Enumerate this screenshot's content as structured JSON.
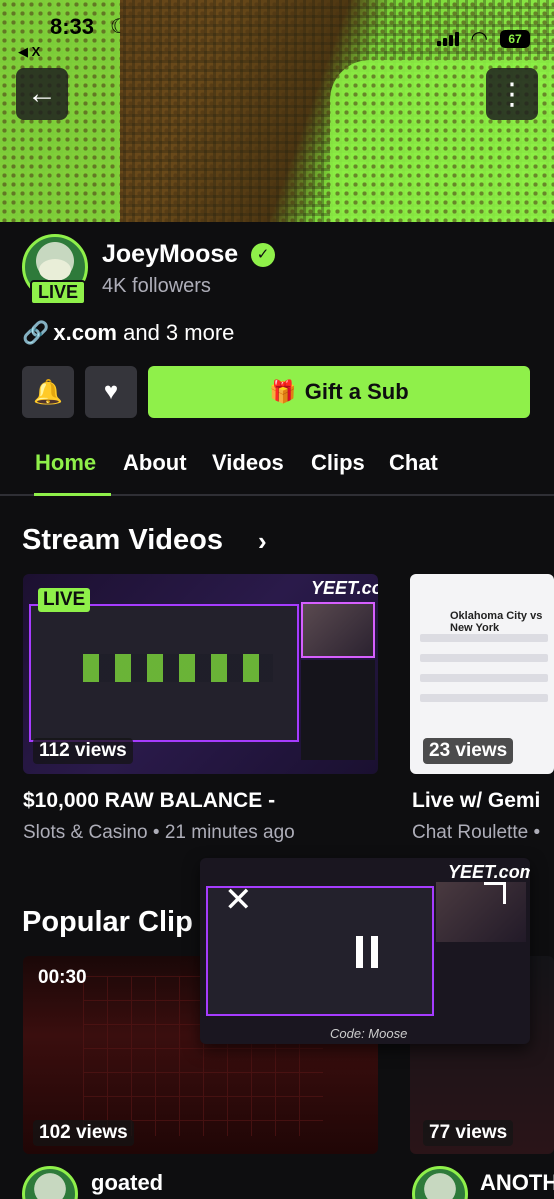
{
  "status_bar": {
    "time": "8:33",
    "back_app": "◀ X",
    "battery": "67"
  },
  "channel": {
    "name": "JoeyMoose",
    "followers": "4K followers",
    "live_badge": "LIVE",
    "links_domain": "x.com",
    "links_more": " and 3 more"
  },
  "actions": {
    "gift_label": "Gift a Sub"
  },
  "tabs": [
    {
      "label": "Home",
      "active": true
    },
    {
      "label": "About"
    },
    {
      "label": "Videos"
    },
    {
      "label": "Clips"
    },
    {
      "label": "Chat"
    }
  ],
  "stream_videos": {
    "title": "Stream Videos",
    "items": [
      {
        "live_tag": "LIVE",
        "views": "112 views",
        "title": "$10,000 RAW BALANCE -",
        "meta": "Slots & Casino • 21 minutes ago",
        "thumb_brand": "YEET.com"
      },
      {
        "views": "23 views",
        "title": "Live w/ Gemi",
        "meta": "Chat Roulette •",
        "thumb_heading": "Oklahoma City vs New York"
      }
    ]
  },
  "popular_clips": {
    "title": "Popular Clip",
    "items": [
      {
        "duration": "00:30",
        "views": "102 views",
        "channel": "goated"
      },
      {
        "views": "77 views",
        "channel": "ANOTH"
      }
    ]
  },
  "pip": {
    "brand": "YEET.com",
    "footer": "Code: Moose"
  },
  "icons": {
    "back": "arrow-left",
    "more": "vertical-dots",
    "bell": "bell",
    "heart": "heart",
    "gift": "gift",
    "link": "link",
    "verified": "check-badge",
    "close": "x",
    "expand": "expand",
    "pause": "pause"
  },
  "colors": {
    "accent": "#8ff04a",
    "background": "#0e0e10",
    "button_gray": "#35353b",
    "muted_text": "#adadb8"
  }
}
